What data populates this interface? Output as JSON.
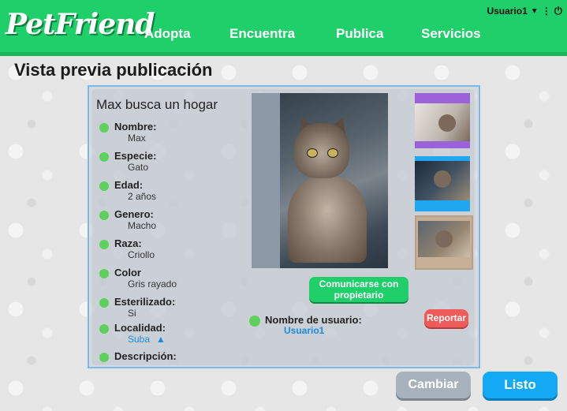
{
  "header": {
    "logo": "PetFriend",
    "nav": [
      "Adopta",
      "Encuentra",
      "Publica",
      "Servicios"
    ],
    "user": "Usuario1",
    "caret_icon": "caret-down-icon",
    "menu_icon": "vertical-dots-icon",
    "power_icon": "power-icon"
  },
  "page": {
    "title": "Vista previa publicación"
  },
  "card": {
    "title": "Max busca un hogar",
    "fields": [
      {
        "label": "Nombre:",
        "value": "Max"
      },
      {
        "label": "Especie:",
        "value": "Gato"
      },
      {
        "label": "Edad:",
        "value": "2 años"
      },
      {
        "label": "Genero:",
        "value": "Macho"
      },
      {
        "label": "Raza:",
        "value": "Criollo"
      },
      {
        "label": "Color",
        "value": "Gris rayado"
      },
      {
        "label": "Esterilizado:",
        "value": "Si"
      },
      {
        "label": "Localidad:",
        "value": "Suba"
      },
      {
        "label": "Descripción:",
        "value": ""
      }
    ],
    "contact_button": "Comunicarse con propietario",
    "username_label": "Nombre de usuario:",
    "username_value": "Usuario1",
    "report_button": "Reportar"
  },
  "footer": {
    "cambiar": "Cambiar",
    "listo": "Listo"
  },
  "colors": {
    "brand_green": "#1fcf69",
    "accent_blue": "#14a9f5",
    "report_red": "#ef5a5a",
    "bullet_green": "#5dd05d"
  }
}
